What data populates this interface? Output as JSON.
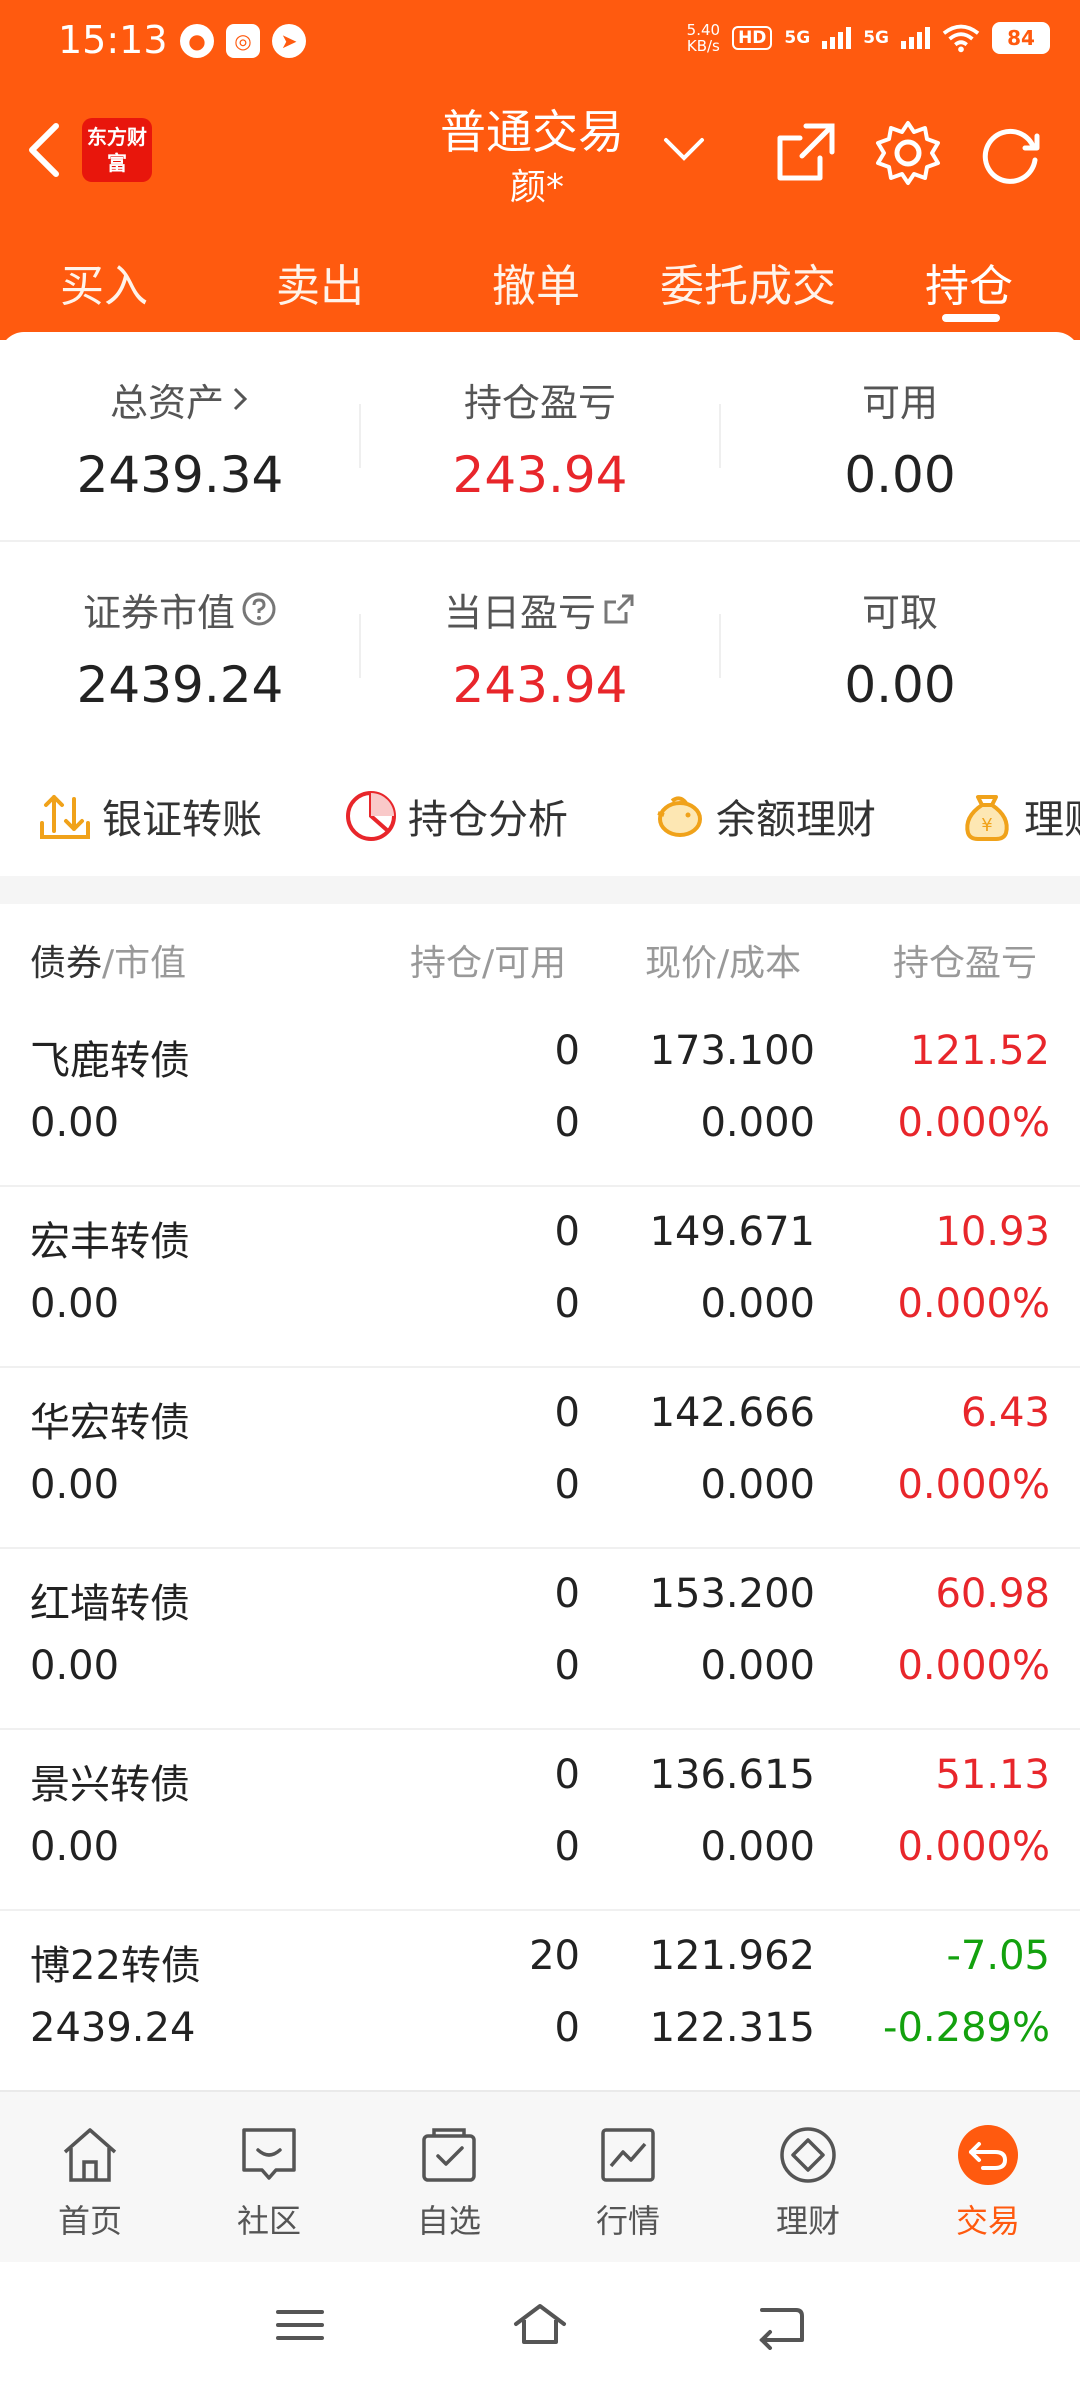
{
  "status_bar": {
    "time": "15:13",
    "net_speed_value": "5.40",
    "net_speed_unit": "KB/s",
    "hd_label": "HD",
    "net1": "5G",
    "net2": "5G",
    "battery": "84"
  },
  "header": {
    "logo_text": "东方财富",
    "title": "普通交易",
    "account": "颜*"
  },
  "tabs": [
    {
      "label": "买入"
    },
    {
      "label": "卖出"
    },
    {
      "label": "撤单"
    },
    {
      "label": "委托成交"
    },
    {
      "label": "持仓",
      "active": true
    }
  ],
  "summary": {
    "total_assets_label": "总资产",
    "total_assets": "2439.34",
    "position_pnl_label": "持仓盈亏",
    "position_pnl": "243.94",
    "available_label": "可用",
    "available": "0.00",
    "market_value_label": "证券市值",
    "market_value": "2439.24",
    "daily_pnl_label": "当日盈亏",
    "daily_pnl": "243.94",
    "withdrawable_label": "可取",
    "withdrawable": "0.00"
  },
  "shortcuts": [
    {
      "label": "银证转账",
      "icon": "transfer-icon"
    },
    {
      "label": "持仓分析",
      "icon": "pie-chart-icon"
    },
    {
      "label": "余额理财",
      "icon": "piggy-bank-icon"
    },
    {
      "label": "理财",
      "icon": "money-bag-icon"
    }
  ],
  "table": {
    "col1_main": "债券",
    "col1_sub": "/市值",
    "col2": "持仓/可用",
    "col3": "现价/成本",
    "col4": "持仓盈亏",
    "rows": [
      {
        "name": "飞鹿转债",
        "market_value": "0.00",
        "holding": "0",
        "available": "0",
        "price": "173.100",
        "cost": "0.000",
        "pnl": "121.52",
        "pnl_pct": "0.000%",
        "trend": "up"
      },
      {
        "name": "宏丰转债",
        "market_value": "0.00",
        "holding": "0",
        "available": "0",
        "price": "149.671",
        "cost": "0.000",
        "pnl": "10.93",
        "pnl_pct": "0.000%",
        "trend": "up"
      },
      {
        "name": "华宏转债",
        "market_value": "0.00",
        "holding": "0",
        "available": "0",
        "price": "142.666",
        "cost": "0.000",
        "pnl": "6.43",
        "pnl_pct": "0.000%",
        "trend": "up"
      },
      {
        "name": "红墙转债",
        "market_value": "0.00",
        "holding": "0",
        "available": "0",
        "price": "153.200",
        "cost": "0.000",
        "pnl": "60.98",
        "pnl_pct": "0.000%",
        "trend": "up"
      },
      {
        "name": "景兴转债",
        "market_value": "0.00",
        "holding": "0",
        "available": "0",
        "price": "136.615",
        "cost": "0.000",
        "pnl": "51.13",
        "pnl_pct": "0.000%",
        "trend": "up"
      },
      {
        "name": "博22转债",
        "market_value": "2439.24",
        "holding": "20",
        "available": "0",
        "price": "121.962",
        "cost": "122.315",
        "pnl": "-7.05",
        "pnl_pct": "-0.289%",
        "trend": "down"
      }
    ]
  },
  "bottom_nav": [
    {
      "label": "首页",
      "icon": "home-icon"
    },
    {
      "label": "社区",
      "icon": "community-icon"
    },
    {
      "label": "自选",
      "icon": "watchlist-icon"
    },
    {
      "label": "行情",
      "icon": "market-icon"
    },
    {
      "label": "理财",
      "icon": "wealth-icon"
    },
    {
      "label": "交易",
      "icon": "trade-icon",
      "active": true
    }
  ],
  "colors": {
    "brand": "#ff5a0f",
    "up": "#e8262b",
    "down": "#13a10e"
  }
}
